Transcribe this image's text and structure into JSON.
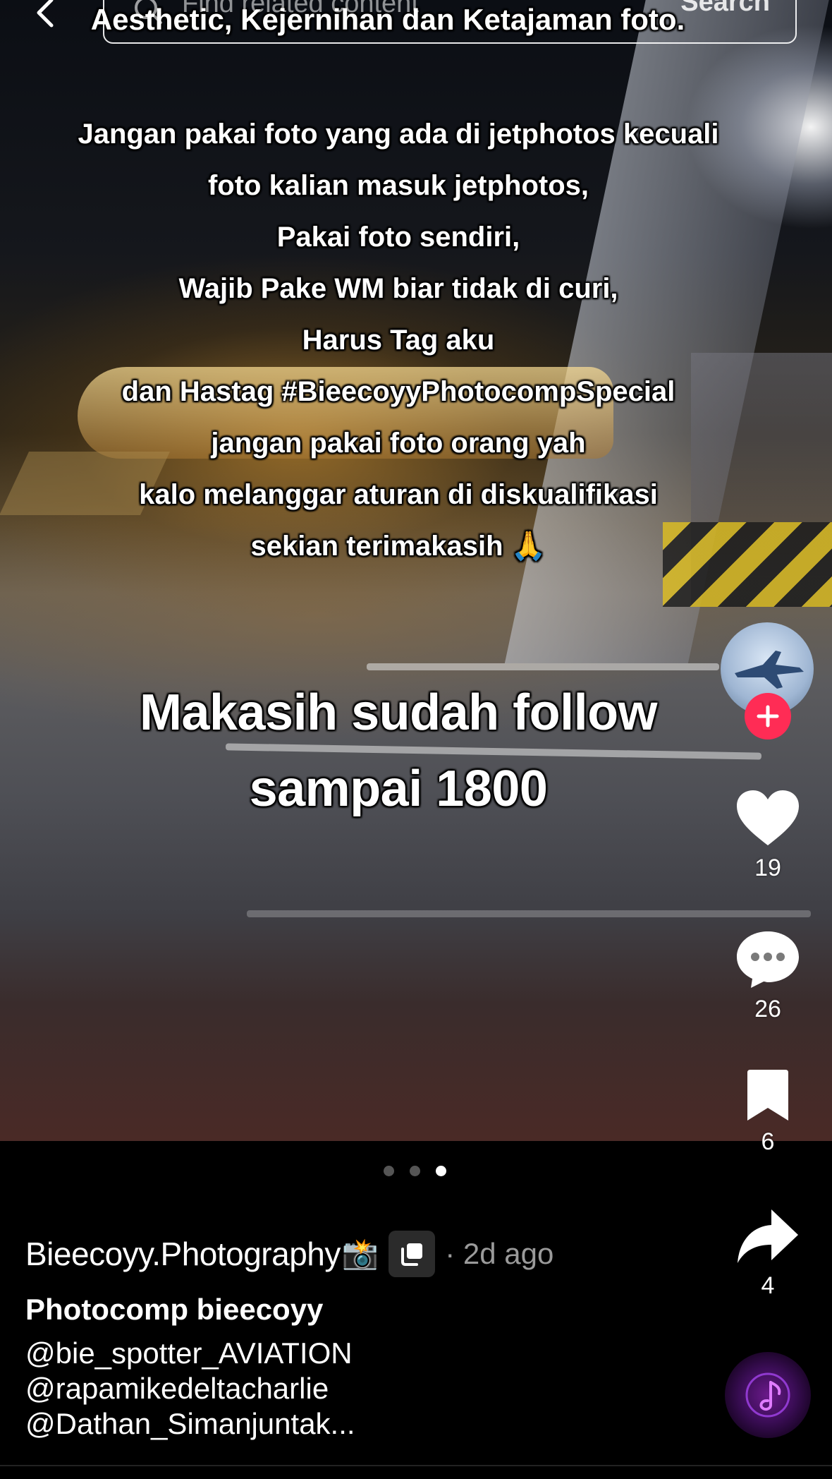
{
  "search": {
    "placeholder": "Find related content",
    "button_label": "Search"
  },
  "overlay": {
    "top_line": "Aesthetic, Kejernihan dan Ketajaman foto.",
    "rules": [
      "Jangan pakai foto yang ada di jetphotos kecuali",
      "foto kalian masuk jetphotos,",
      "Pakai foto sendiri,",
      "Wajib Pake WM biar tidak di curi,",
      "Harus Tag aku",
      "dan Hastag #BieecoyyPhotocompSpecial",
      "jangan pakai foto orang yah",
      "kalo melanggar aturan di diskualifikasi",
      "sekian terimakasih 🙏"
    ],
    "headline_1": "Makasih sudah follow",
    "headline_2": "sampai 1800"
  },
  "actions": {
    "likes": "19",
    "comments": "26",
    "saves": "6",
    "shares": "4"
  },
  "pager": {
    "total": 3,
    "active": 3
  },
  "post": {
    "author": "Bieecoyy.Photography",
    "author_emoji": "📸",
    "time": "· 2d ago",
    "title": "Photocomp bieecoyy",
    "mentions": [
      "@bie_spotter_AVIATION",
      "@rapamikedeltacharlie",
      "@Dathan_Simanjuntak..."
    ]
  },
  "colors": {
    "follow_accent": "#ff2c55",
    "time_gray": "#9a9a9a"
  },
  "icons": [
    "back-arrow-icon",
    "search-icon",
    "plus-icon",
    "heart-icon",
    "comment-icon",
    "bookmark-icon",
    "share-icon",
    "repost-icon",
    "music-disc-icon"
  ]
}
